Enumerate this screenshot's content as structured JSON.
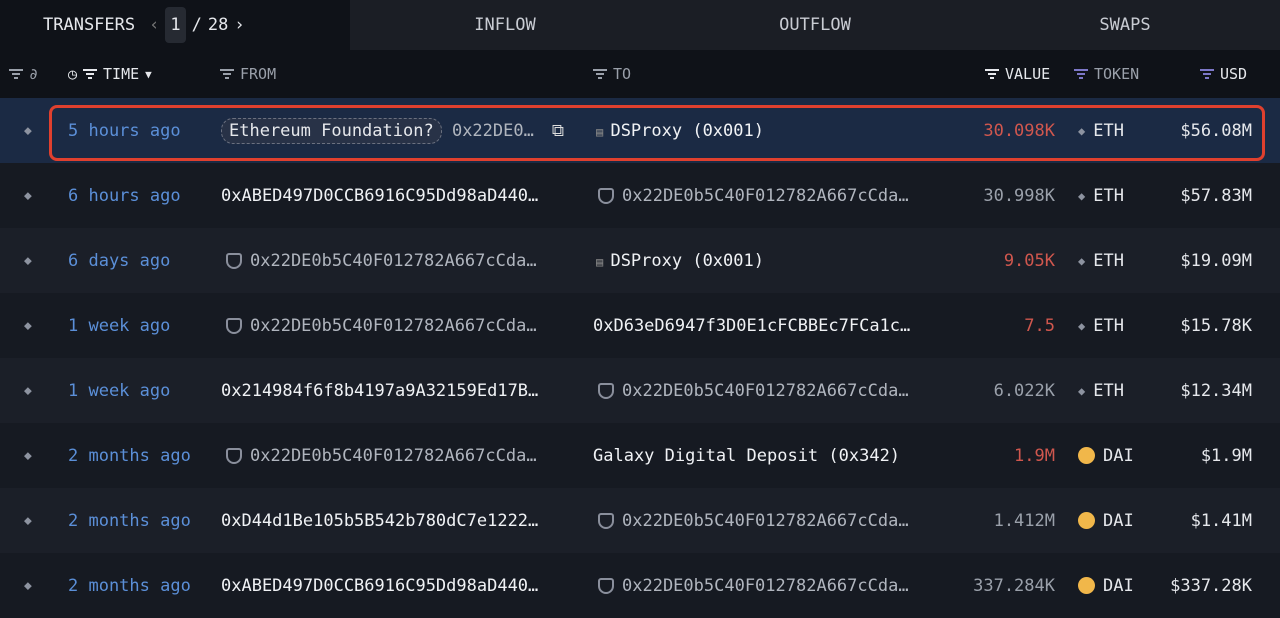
{
  "tabs": {
    "transfers": "TRANSFERS",
    "page": "1",
    "page_sep": "/",
    "total_pages": "28",
    "inflow": "INFLOW",
    "outflow": "OUTFLOW",
    "swaps": "SWAPS"
  },
  "columns": {
    "time": "TIME",
    "from": "FROM",
    "to": "TO",
    "value": "VALUE",
    "token": "TOKEN",
    "usd": "USD"
  },
  "colors": {
    "accent_time": "#5b8fd8",
    "outflow_value": "#d0574e",
    "highlight_border": "#e0402e"
  },
  "rows": [
    {
      "time": "5 hours ago",
      "from_label": "Ethereum Foundation?",
      "from": "0x22DE0…",
      "to": "DSProxy (0x001)",
      "value": "30.098K",
      "token": "ETH",
      "usd": "$56.08M"
    },
    {
      "time": "6 hours ago",
      "from": "0xABED497D0CCB6916C95Dd98aD440…",
      "to": "0x22DE0b5C40F012782A667cCda…",
      "value": "30.998K",
      "token": "ETH",
      "usd": "$57.83M"
    },
    {
      "time": "6 days ago",
      "from": "0x22DE0b5C40F012782A667cCda…",
      "to": "DSProxy (0x001)",
      "value": "9.05K",
      "token": "ETH",
      "usd": "$19.09M"
    },
    {
      "time": "1 week ago",
      "from": "0x22DE0b5C40F012782A667cCda…",
      "to": "0xD63eD6947f3D0E1cFCBBEc7FCa1c…",
      "value": "7.5",
      "token": "ETH",
      "usd": "$15.78K"
    },
    {
      "time": "1 week ago",
      "from": "0x214984f6f8b4197a9A32159Ed17B…",
      "to": "0x22DE0b5C40F012782A667cCda…",
      "value": "6.022K",
      "token": "ETH",
      "usd": "$12.34M"
    },
    {
      "time": "2 months ago",
      "from": "0x22DE0b5C40F012782A667cCda…",
      "to": "Galaxy Digital Deposit (0x342)",
      "value": "1.9M",
      "token": "DAI",
      "usd": "$1.9M"
    },
    {
      "time": "2 months ago",
      "from": "0xD44d1Be105b5B542b780dC7e1222…",
      "to": "0x22DE0b5C40F012782A667cCda…",
      "value": "1.412M",
      "token": "DAI",
      "usd": "$1.41M"
    },
    {
      "time": "2 months ago",
      "from": "0xABED497D0CCB6916C95Dd98aD440…",
      "to": "0x22DE0b5C40F012782A667cCda…",
      "value": "337.284K",
      "token": "DAI",
      "usd": "$337.28K"
    }
  ]
}
